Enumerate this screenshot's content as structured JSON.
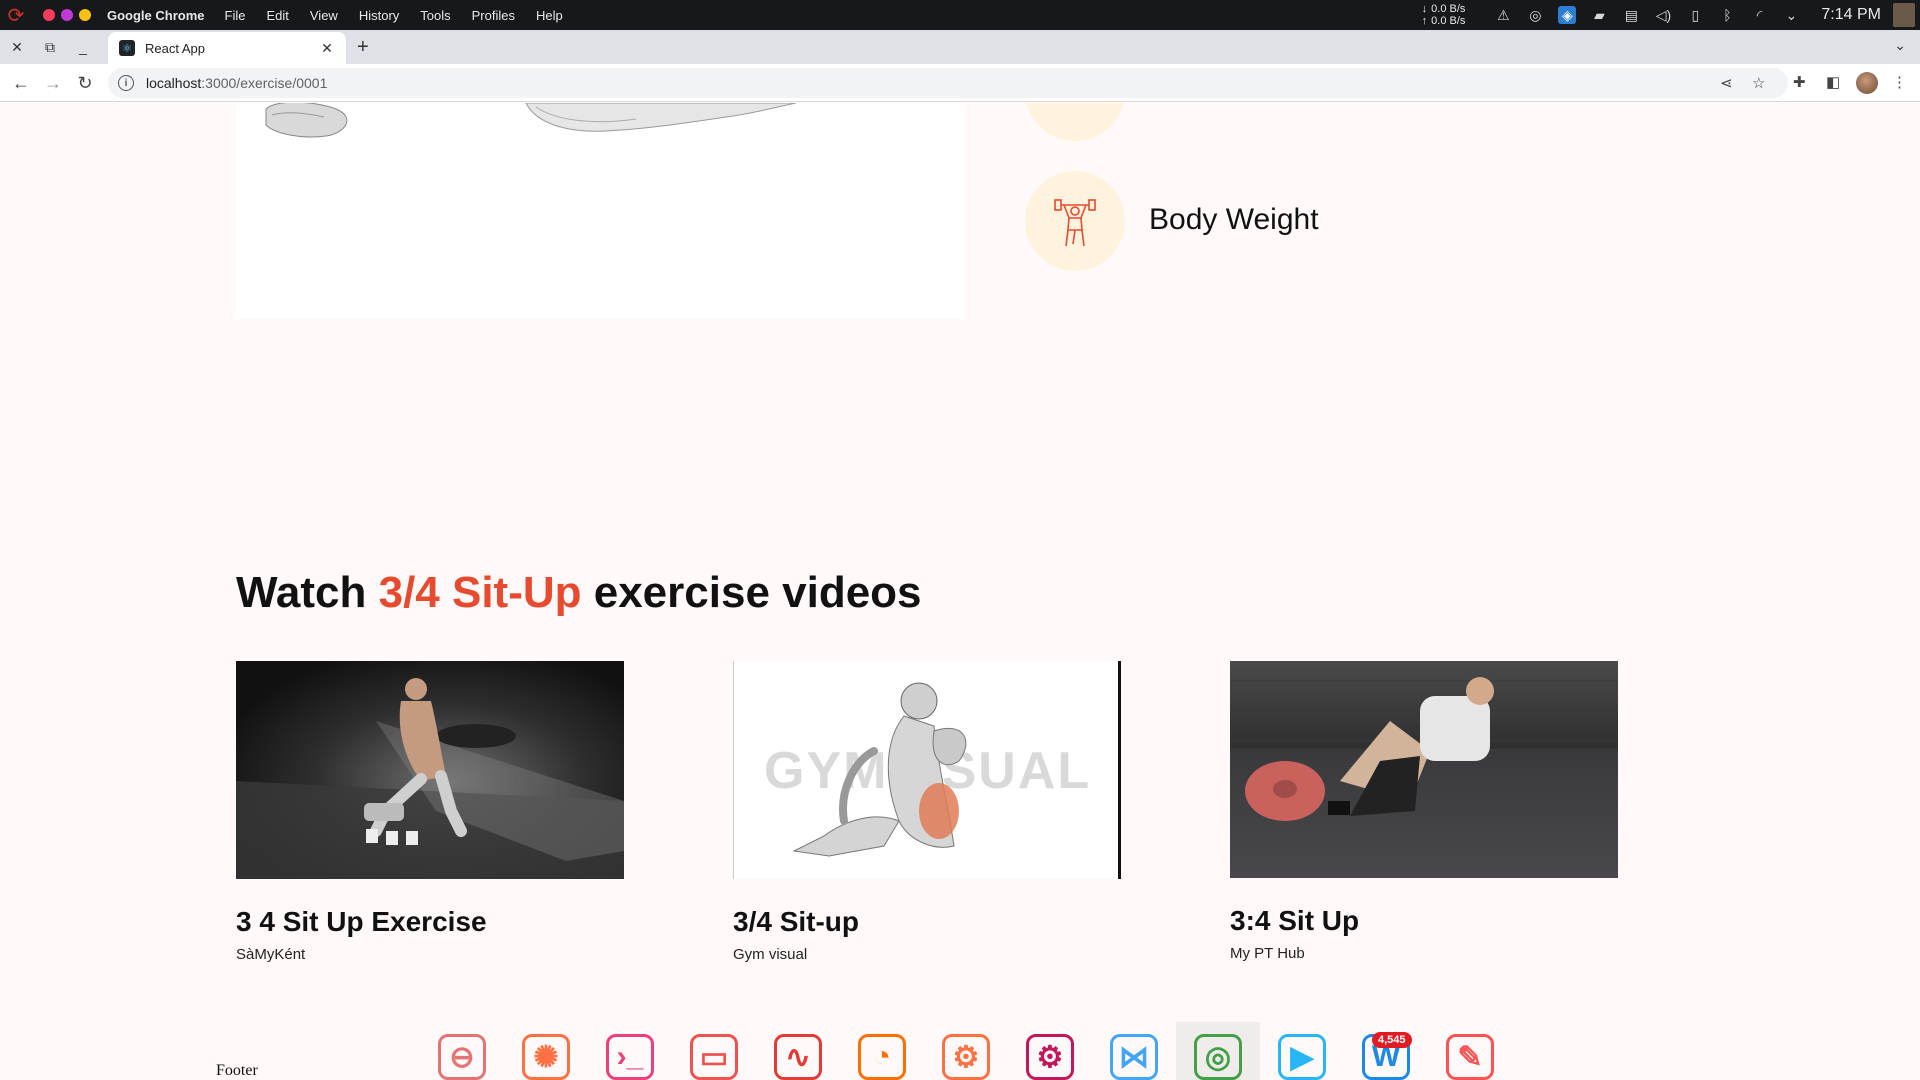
{
  "os": {
    "app_name": "Google Chrome",
    "menu": [
      "File",
      "Edit",
      "View",
      "History",
      "Tools",
      "Profiles",
      "Help"
    ],
    "net_down": "0.0 B/s",
    "net_up": "0.0 B/s",
    "clock": "7:14 PM"
  },
  "browser": {
    "tab_title": "React App",
    "url_host": "localhost",
    "url_path": ":3000/exercise/0001"
  },
  "page": {
    "equipment_label": "Body Weight",
    "videos_heading_prefix": "Watch ",
    "videos_heading_accent": "3/4 Sit-Up",
    "videos_heading_suffix": " exercise videos",
    "videos": [
      {
        "title": "3 4 Sit Up Exercise",
        "channel": "SàMyKént"
      },
      {
        "title": "3/4 Sit-up",
        "channel": "Gym visual",
        "watermark": "GYMVISUAL"
      },
      {
        "title": "3:4 Sit Up",
        "channel": "My PT Hub"
      }
    ],
    "footer": "Footer"
  },
  "dock": {
    "items": [
      {
        "name": "dock-app-1",
        "glyph": "⊖",
        "color": "#e57373"
      },
      {
        "name": "dock-app-2",
        "glyph": "✺",
        "color": "#ff7043"
      },
      {
        "name": "dock-terminal",
        "glyph": "›_",
        "color": "#ec407a"
      },
      {
        "name": "dock-files",
        "glyph": "▭",
        "color": "#ef5350"
      },
      {
        "name": "dock-monitor",
        "glyph": "∿",
        "color": "#e53935"
      },
      {
        "name": "dock-disk",
        "glyph": "◔",
        "color": "#ff6f00"
      },
      {
        "name": "dock-app-7",
        "glyph": "⚙",
        "color": "#ff7043"
      },
      {
        "name": "dock-settings",
        "glyph": "⚙",
        "color": "#c2185b"
      },
      {
        "name": "dock-vscode",
        "glyph": "⋈",
        "color": "#42a5f5"
      },
      {
        "name": "dock-chrome",
        "glyph": "◎",
        "color": "#43a047"
      },
      {
        "name": "dock-player",
        "glyph": "▶",
        "color": "#29b6f6"
      },
      {
        "name": "dock-app-12",
        "glyph": "W",
        "color": "#1e88e5",
        "badge": "4,545"
      },
      {
        "name": "dock-editor",
        "glyph": "✎",
        "color": "#ff5252"
      }
    ]
  }
}
